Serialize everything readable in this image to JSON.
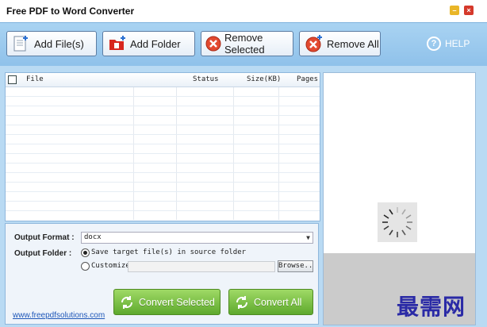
{
  "window": {
    "title": "Free PDF to Word Converter"
  },
  "toolbar": {
    "add_files": "Add File(s)",
    "add_folder": "Add Folder",
    "remove_selected": "Remove Selected",
    "remove_all": "Remove All",
    "help": "HELP"
  },
  "file_list": {
    "columns": {
      "file": "File",
      "status": "Status",
      "size": "Size(KB)",
      "pages": "Pages"
    },
    "rows": []
  },
  "options": {
    "output_format_label": "Output Format :",
    "output_format_value": "docx",
    "output_folder_label": "Output Folder :",
    "save_in_source": "Save target file(s) in source folder",
    "customize": "Customize",
    "custom_path": "",
    "browse": "Browse.."
  },
  "actions": {
    "convert_selected": "Convert Selected",
    "convert_all": "Convert All"
  },
  "footer": {
    "website": "www.freepdfsolutions.com"
  },
  "watermark": "最需网",
  "colors": {
    "toolbar_blue": "#a9d3f2",
    "convert_green": "#5ea92d",
    "remove_red": "#e2492f",
    "folder_red": "#d7261e"
  }
}
